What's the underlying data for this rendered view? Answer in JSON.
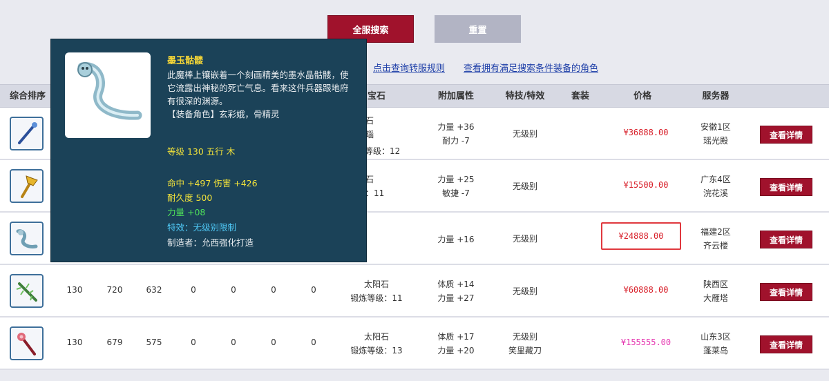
{
  "toolbar": {
    "search_label": "全服搜索",
    "reset_label": "重置",
    "link_rules": "点击查询转服规则",
    "link_match": "查看拥有满足搜索条件装备的角色"
  },
  "headers": {
    "sort": "综合排序",
    "gem": "宝石",
    "extra": "附加属性",
    "skill": "特技/特效",
    "set": "套装",
    "price": "价格",
    "server": "服务器"
  },
  "rows": [
    {
      "c1": "",
      "c2": "",
      "c3": "",
      "c4": "",
      "c5": "",
      "c6": "",
      "c7": "",
      "gem1": "太阳石",
      "gem2": "红玛瑙",
      "gem3": "等级：12",
      "attr1": "力量 +36",
      "attr2": "耐力 -7",
      "skill1": "无级别",
      "skill2": "",
      "price": "¥36888.00",
      "server1": "安徽1区",
      "server2": "瑶光殿",
      "detail": "查看详情"
    },
    {
      "c1": "",
      "c2": "",
      "c3": "",
      "c4": "",
      "c5": "",
      "c6": "",
      "c7": "",
      "gem1": "太阳石",
      "gem2": "等级：11",
      "gem3": "",
      "attr1": "力量 +25",
      "attr2": "敏捷 -7",
      "skill1": "无级别",
      "skill2": "",
      "price": "¥15500.00",
      "server1": "广东4区",
      "server2": "浣花溪",
      "detail": "查看详情"
    },
    {
      "c1": "",
      "c2": "",
      "c3": "",
      "c4": "",
      "c5": "",
      "c6": "",
      "c7": "",
      "gem1": "",
      "gem2": "",
      "gem3": "",
      "attr1": "力量 +16",
      "attr2": "",
      "skill1": "无级别",
      "skill2": "",
      "price": "¥24888.00",
      "server1": "福建2区",
      "server2": "齐云楼",
      "detail": "查看详情"
    },
    {
      "c1": "130",
      "c2": "720",
      "c3": "632",
      "c4": "0",
      "c5": "0",
      "c6": "0",
      "c7": "0",
      "gem1": "太阳石",
      "gem2": "锻炼等级：11",
      "gem3": "",
      "attr1": "体质 +14",
      "attr2": "力量 +27",
      "skill1": "无级别",
      "skill2": "",
      "price": "¥60888.00",
      "server1": "陕西区",
      "server2": "大雁塔",
      "detail": "查看详情"
    },
    {
      "c1": "130",
      "c2": "679",
      "c3": "575",
      "c4": "0",
      "c5": "0",
      "c6": "0",
      "c7": "0",
      "gem1": "太阳石",
      "gem2": "锻炼等级：13",
      "gem3": "",
      "attr1": "体质 +17",
      "attr2": "力量 +20",
      "skill1": "无级别",
      "skill2": "笑里藏刀",
      "price": "¥155555.00",
      "server1": "山东3区",
      "server2": "蓬莱岛",
      "detail": "查看详情"
    }
  ],
  "tooltip": {
    "name": "墨玉骷髅",
    "desc": "此魔棒上镶嵌着一个刻画精美的墨水晶骷髅，使它流露出神秘的死亡气息。看来这件兵器跟地府有很深的渊源。",
    "role": "【装备角色】玄彩娥，骨精灵",
    "level": "等级 130  五行 木",
    "hit_dmg": "命中 +497  伤害 +426",
    "durability": "耐久度 500",
    "strength": "力量 +08",
    "effect": "特效：无级别限制",
    "maker": "制造者：允西强化打造"
  },
  "colors": {
    "primary_button": "#a0122c",
    "secondary_button": "#b2b4c4",
    "tooltip_bg": "#1b4258",
    "price_red": "#d8202a",
    "price_pink": "#e536b0"
  }
}
